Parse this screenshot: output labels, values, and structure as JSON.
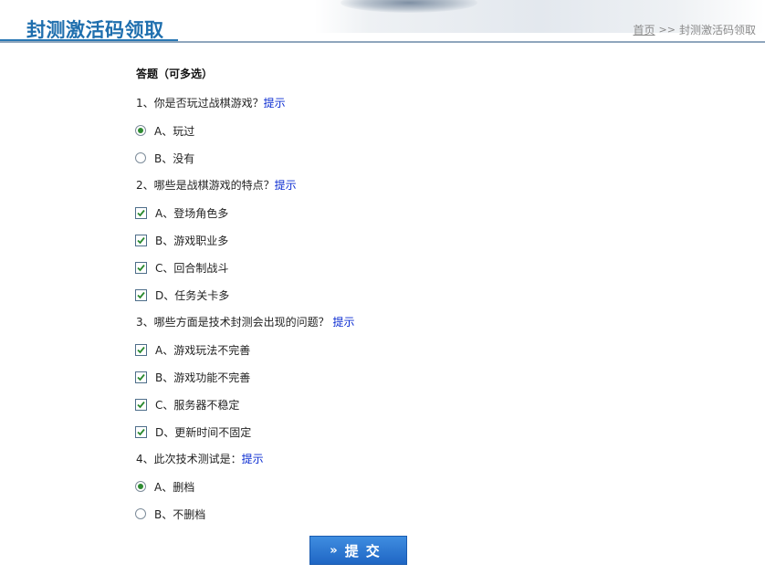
{
  "header": {
    "title": "封测激活码领取",
    "breadcrumb": {
      "home": "首页",
      "separator": ">>",
      "current": "封测激活码领取"
    }
  },
  "form": {
    "heading": "答题（可多选）",
    "hint_label": "提示",
    "questions": [
      {
        "text": "1、你是否玩过战棋游戏？",
        "type": "radio",
        "options": [
          {
            "label": "A、玩过",
            "checked": true
          },
          {
            "label": "B、没有",
            "checked": false
          }
        ]
      },
      {
        "text": "2、哪些是战棋游戏的特点？",
        "type": "checkbox",
        "options": [
          {
            "label": "A、登场角色多",
            "checked": true
          },
          {
            "label": "B、游戏职业多",
            "checked": true
          },
          {
            "label": "C、回合制战斗",
            "checked": true
          },
          {
            "label": "D、任务关卡多",
            "checked": true
          }
        ]
      },
      {
        "text": "3、哪些方面是技术封测会出现的问题？",
        "type": "checkbox",
        "options": [
          {
            "label": "A、游戏玩法不完善",
            "checked": true
          },
          {
            "label": "B、游戏功能不完善",
            "checked": true
          },
          {
            "label": "C、服务器不稳定",
            "checked": true
          },
          {
            "label": "D、更新时间不固定",
            "checked": true
          }
        ]
      },
      {
        "text": "4、此次技术测试是：",
        "type": "radio",
        "options": [
          {
            "label": "A、删档",
            "checked": true
          },
          {
            "label": "B、不删档",
            "checked": false
          }
        ]
      }
    ],
    "submit": {
      "arrow": "»",
      "label": "提交"
    }
  },
  "colors": {
    "title": "#1f6fae",
    "link": "#0a2bd1",
    "button": "#2a78d0",
    "radio_dot": "#2e8b32"
  }
}
